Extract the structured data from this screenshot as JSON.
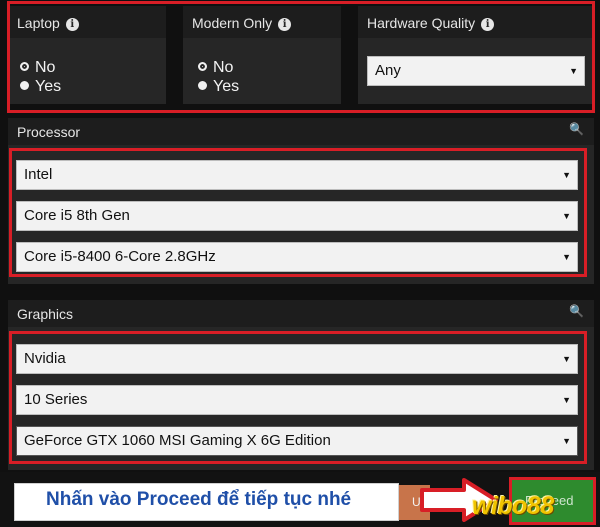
{
  "filters": {
    "laptop": {
      "title": "Laptop",
      "options": [
        "No",
        "Yes"
      ],
      "selected": "No"
    },
    "modern_only": {
      "title": "Modern Only",
      "options": [
        "No",
        "Yes"
      ],
      "selected": "No"
    },
    "hardware_quality": {
      "title": "Hardware Quality",
      "value": "Any"
    }
  },
  "processor": {
    "title": "Processor",
    "brand": "Intel",
    "series": "Core i5 8th Gen",
    "model": "Core i5-8400 6-Core 2.8GHz"
  },
  "graphics": {
    "title": "Graphics",
    "brand": "Nvidia",
    "series": "10 Series",
    "model": "GeForce GTX 1060 MSI Gaming X 6G Edition"
  },
  "overlay": {
    "instruction": "Nhấn vào Proceed để tiếp tục nhé",
    "proceed_label": "Proceed",
    "watermark": "wibo88"
  },
  "colors": {
    "highlight_red": "#d81e26",
    "proceed_green": "#2e8b2e",
    "instruction_text": "#1f4fa8"
  }
}
